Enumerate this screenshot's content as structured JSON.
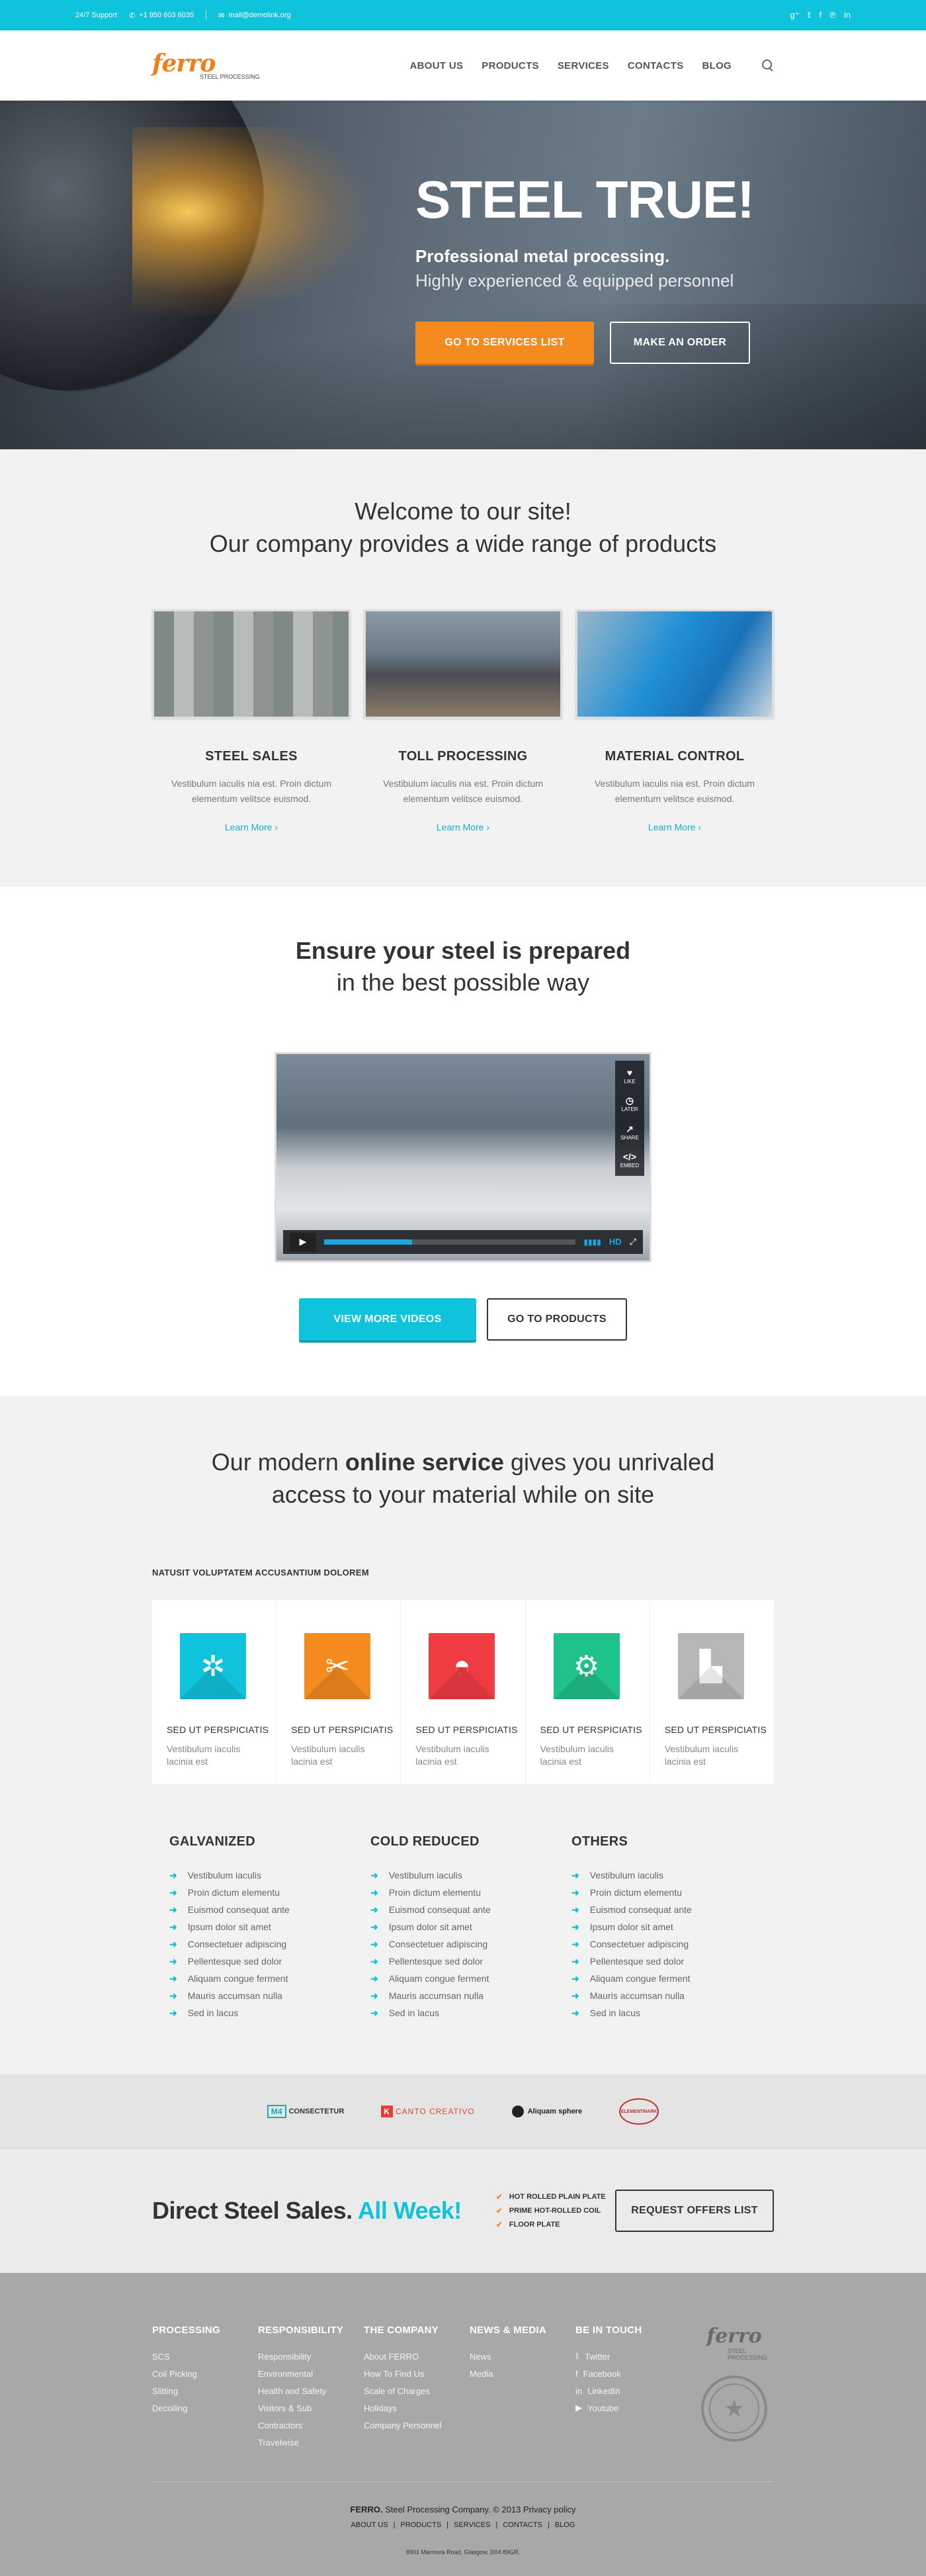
{
  "topbar": {
    "support_label": "24/7 Support",
    "phone": "+1 950 603 6035",
    "email": "mail@demolink.org",
    "social_icons": [
      "google-plus-icon",
      "twitter-icon",
      "facebook-icon",
      "pinterest-icon",
      "linkedin-icon"
    ]
  },
  "header": {
    "logo_name": "ferro",
    "logo_sub": "STEEL PROCESSING",
    "nav": [
      "ABOUT US",
      "PRODUCTS",
      "SERVICES",
      "CONTACTS",
      "BLOG"
    ]
  },
  "hero": {
    "title": "STEEL TRUE!",
    "line1": "Professional metal processing.",
    "line2": "Highly experienced & equipped personnel",
    "btn_primary": "GO TO SERVICES LIST",
    "btn_secondary": "MAKE AN ORDER"
  },
  "welcome": {
    "line1": "Welcome to our site!",
    "line2": "Our company provides a wide range of products",
    "cards": [
      {
        "title": "STEEL SALES",
        "text": "Vestibulum iaculis nia est. Proin dictum elementum velitsce euismod.",
        "more": "Learn More"
      },
      {
        "title": "TOLL PROCESSING",
        "text": "Vestibulum iaculis nia est. Proin dictum elementum velitsce euismod.",
        "more": "Learn More"
      },
      {
        "title": "MATERIAL CONTROL",
        "text": "Vestibulum iaculis nia est. Proin dictum elementum velitsce euismod.",
        "more": "Learn More"
      }
    ]
  },
  "ensure": {
    "title": "Ensure your steel is prepared",
    "subtitle": "in the best possible way",
    "video": {
      "side": [
        "LIKE",
        "LATER",
        "SHARE",
        "EMBED"
      ],
      "hd": "HD",
      "progress": 0.35
    },
    "btn_primary": "VIEW MORE VIDEOS",
    "btn_secondary": "GO TO PRODUCTS"
  },
  "online": {
    "title_pre": "Our modern ",
    "title_bold": "online service",
    "title_post": " gives you unrivaled",
    "title_line2": "access to your material while on site",
    "label": "NATUSIT VOLUPTATEM ACCUSANTIUM DOLOREM",
    "services": [
      {
        "icon": "gear-icon",
        "color": "#10c3dc",
        "title": "SED UT PERSPICIATIS",
        "text": "Vestibulum iaculis lacinia est"
      },
      {
        "icon": "pliers-icon",
        "color": "#f58a1f",
        "title": "SED UT PERSPICIATIS",
        "text": "Vestibulum iaculis lacinia est"
      },
      {
        "icon": "hard-hat-icon",
        "color": "#ef3b42",
        "title": "SED UT PERSPICIATIS",
        "text": "Vestibulum iaculis lacinia est"
      },
      {
        "icon": "machine-gear-icon",
        "color": "#1fc28a",
        "title": "SED UT PERSPICIATIS",
        "text": "Vestibulum iaculis lacinia est"
      },
      {
        "icon": "factory-icon",
        "color": "#b7b7b7",
        "title": "SED UT PERSPICIATIS",
        "text": "Vestibulum iaculis lacinia est"
      }
    ],
    "lists": [
      {
        "title": "GALVANIZED",
        "items": [
          "Vestibulum iaculis",
          "Proin dictum elementu",
          "Euismod consequat ante",
          "Ipsum dolor sit amet",
          "Consectetuer adipiscing",
          "Pellentesque sed dolor",
          "Aliquam congue ferment",
          "Mauris accumsan nulla",
          "Sed in lacus"
        ]
      },
      {
        "title": "COLD REDUCED",
        "items": [
          "Vestibulum iaculis",
          "Proin dictum elementu",
          "Euismod consequat ante",
          "Ipsum dolor sit amet",
          "Consectetuer adipiscing",
          "Pellentesque sed dolor",
          "Aliquam congue ferment",
          "Mauris accumsan nulla",
          "Sed in lacus"
        ]
      },
      {
        "title": "OTHERS",
        "items": [
          "Vestibulum iaculis",
          "Proin dictum elementu",
          "Euismod consequat ante",
          "Ipsum dolor sit amet",
          "Consectetuer adipiscing",
          "Pellentesque sed dolor",
          "Aliquam congue ferment",
          "Mauris accumsan nulla",
          "Sed in lacus"
        ]
      }
    ]
  },
  "partners": {
    "p1_mark": "M4",
    "p1_text": "CONSECTETUR",
    "p2_mark": "K",
    "p2_text": "CANTO CREATIVO",
    "p3_text": "Aliquam sphere",
    "p4_text": "ELEMENTMARK"
  },
  "direct": {
    "title": "Direct Steel Sales.",
    "title_accent": "All Week!",
    "items": [
      "HOT ROLLED PLAIN PLATE",
      "PRIME HOT-ROLLED COIL",
      "FLOOR PLATE"
    ],
    "button": "REQUEST OFFERS LIST"
  },
  "footer": {
    "columns": [
      {
        "title": "PROCESSING",
        "items": [
          "SCS",
          "Coil Picking",
          "Slitting",
          "Decoiling"
        ]
      },
      {
        "title": "RESPONSIBILITY",
        "items": [
          "Responsibility",
          "Environmental",
          "Health and Safety",
          "Visitors & Sub",
          "Contractors",
          "Travelwise"
        ]
      },
      {
        "title": "THE COMPANY",
        "items": [
          "About FERRO",
          "How To Find Us",
          "Scale of Charges",
          "Holidays",
          "Company Personnel"
        ]
      },
      {
        "title": "NEWS & MEDIA",
        "items": [
          "News",
          "Media"
        ]
      },
      {
        "title": "BE IN TOUCH",
        "items": [
          "Twitter",
          "Facebook",
          "LinkedIn",
          "Youtube"
        ],
        "icons": [
          "twitter-icon",
          "facebook-icon",
          "linkedin-icon",
          "youtube-icon"
        ]
      }
    ],
    "brand_name": "ferro",
    "brand_sub": "STEEL PROCESSING",
    "copy_brand": "FERRO.",
    "copy_text": " Steel Processing Company. © 2013 Privacy policy",
    "links": [
      "ABOUT US",
      "PRODUCTS",
      "SERVICES",
      "CONTACTS",
      "BLOG"
    ],
    "address": "8901 Marmora Road, Glasgow, D04 89GR."
  }
}
